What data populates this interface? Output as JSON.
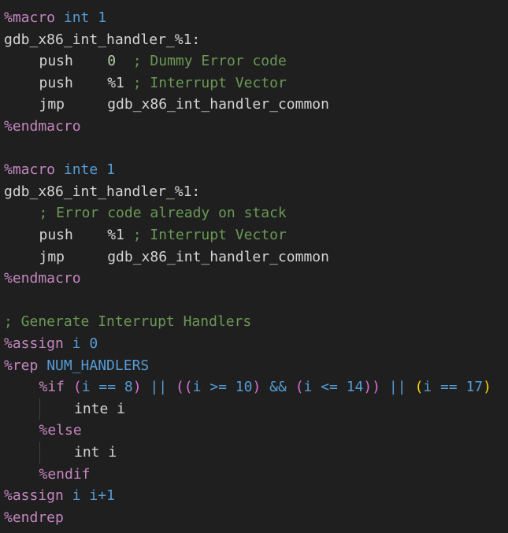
{
  "lines": [
    {
      "indent": 0,
      "tokens": [
        {
          "t": "%macro",
          "c": "directive"
        },
        {
          "t": " ",
          "c": "ident"
        },
        {
          "t": "int",
          "c": "keyword"
        },
        {
          "t": " ",
          "c": "ident"
        },
        {
          "t": "1",
          "c": "keyword"
        }
      ]
    },
    {
      "indent": 0,
      "tokens": [
        {
          "t": "gdb_x86_int_handler_%1:",
          "c": "ident"
        }
      ]
    },
    {
      "indent": 1,
      "tokens": [
        {
          "t": "push    ",
          "c": "ident"
        },
        {
          "t": "0",
          "c": "number"
        },
        {
          "t": "  ",
          "c": "ident"
        },
        {
          "t": "; Dummy Error code",
          "c": "comment"
        }
      ]
    },
    {
      "indent": 1,
      "tokens": [
        {
          "t": "push    ",
          "c": "ident"
        },
        {
          "t": "%1",
          "c": "ident"
        },
        {
          "t": " ",
          "c": "ident"
        },
        {
          "t": "; Interrupt Vector",
          "c": "comment"
        }
      ]
    },
    {
      "indent": 1,
      "tokens": [
        {
          "t": "jmp     ",
          "c": "ident"
        },
        {
          "t": "gdb_x86_int_handler_common",
          "c": "ident"
        }
      ]
    },
    {
      "indent": 0,
      "tokens": [
        {
          "t": "%endmacro",
          "c": "directive"
        }
      ]
    },
    {
      "indent": 0,
      "tokens": []
    },
    {
      "indent": 0,
      "tokens": [
        {
          "t": "%macro",
          "c": "directive"
        },
        {
          "t": " ",
          "c": "ident"
        },
        {
          "t": "inte",
          "c": "keyword"
        },
        {
          "t": " ",
          "c": "ident"
        },
        {
          "t": "1",
          "c": "keyword"
        }
      ]
    },
    {
      "indent": 0,
      "tokens": [
        {
          "t": "gdb_x86_int_handler_%1:",
          "c": "ident"
        }
      ]
    },
    {
      "indent": 1,
      "tokens": [
        {
          "t": "; Error code already on stack",
          "c": "comment"
        }
      ]
    },
    {
      "indent": 1,
      "tokens": [
        {
          "t": "push    ",
          "c": "ident"
        },
        {
          "t": "%1",
          "c": "ident"
        },
        {
          "t": " ",
          "c": "ident"
        },
        {
          "t": "; Interrupt Vector",
          "c": "comment"
        }
      ]
    },
    {
      "indent": 1,
      "tokens": [
        {
          "t": "jmp     ",
          "c": "ident"
        },
        {
          "t": "gdb_x86_int_handler_common",
          "c": "ident"
        }
      ]
    },
    {
      "indent": 0,
      "tokens": [
        {
          "t": "%endmacro",
          "c": "directive"
        }
      ]
    },
    {
      "indent": 0,
      "tokens": []
    },
    {
      "indent": 0,
      "tokens": [
        {
          "t": "; Generate Interrupt Handlers",
          "c": "comment"
        }
      ]
    },
    {
      "indent": 0,
      "tokens": [
        {
          "t": "%assign",
          "c": "directive"
        },
        {
          "t": " ",
          "c": "ident"
        },
        {
          "t": "i",
          "c": "keyword"
        },
        {
          "t": " ",
          "c": "ident"
        },
        {
          "t": "0",
          "c": "keyword"
        }
      ]
    },
    {
      "indent": 0,
      "tokens": [
        {
          "t": "%rep",
          "c": "directive"
        },
        {
          "t": " ",
          "c": "ident"
        },
        {
          "t": "NUM_HANDLERS",
          "c": "keyword"
        }
      ]
    },
    {
      "indent": 1,
      "tokens": [
        {
          "t": "%if",
          "c": "directive"
        },
        {
          "t": " ",
          "c": "ident"
        },
        {
          "t": "(",
          "c": "bracket2"
        },
        {
          "t": "i == 8",
          "c": "keyword"
        },
        {
          "t": ")",
          "c": "bracket2"
        },
        {
          "t": " || ",
          "c": "keyword"
        },
        {
          "t": "(",
          "c": "bracket2"
        },
        {
          "t": "(",
          "c": "bracket2"
        },
        {
          "t": "i >= 10",
          "c": "keyword"
        },
        {
          "t": ")",
          "c": "bracket2"
        },
        {
          "t": " && ",
          "c": "keyword"
        },
        {
          "t": "(",
          "c": "bracket2"
        },
        {
          "t": "i <= 14",
          "c": "keyword"
        },
        {
          "t": ")",
          "c": "bracket2"
        },
        {
          "t": ")",
          "c": "bracket2"
        },
        {
          "t": " || ",
          "c": "keyword"
        },
        {
          "t": "(",
          "c": "bracket1"
        },
        {
          "t": "i == 17",
          "c": "keyword"
        },
        {
          "t": ")",
          "c": "bracket1"
        }
      ]
    },
    {
      "indent": 2,
      "tokens": [
        {
          "t": "inte i",
          "c": "ident"
        }
      ]
    },
    {
      "indent": 1,
      "tokens": [
        {
          "t": "%else",
          "c": "directive"
        }
      ]
    },
    {
      "indent": 2,
      "tokens": [
        {
          "t": "int i",
          "c": "ident"
        }
      ]
    },
    {
      "indent": 1,
      "tokens": [
        {
          "t": "%endif",
          "c": "directive"
        }
      ]
    },
    {
      "indent": 0,
      "tokens": [
        {
          "t": "%assign",
          "c": "directive"
        },
        {
          "t": " ",
          "c": "ident"
        },
        {
          "t": "i i+1",
          "c": "keyword"
        }
      ]
    },
    {
      "indent": 0,
      "tokens": [
        {
          "t": "%endrep",
          "c": "directive"
        }
      ]
    }
  ],
  "colors": {
    "background": "#1f1f1f",
    "directive": "#c586c0",
    "keyword": "#569cd6",
    "comment": "#6a9955",
    "text": "#d4d4d4"
  }
}
